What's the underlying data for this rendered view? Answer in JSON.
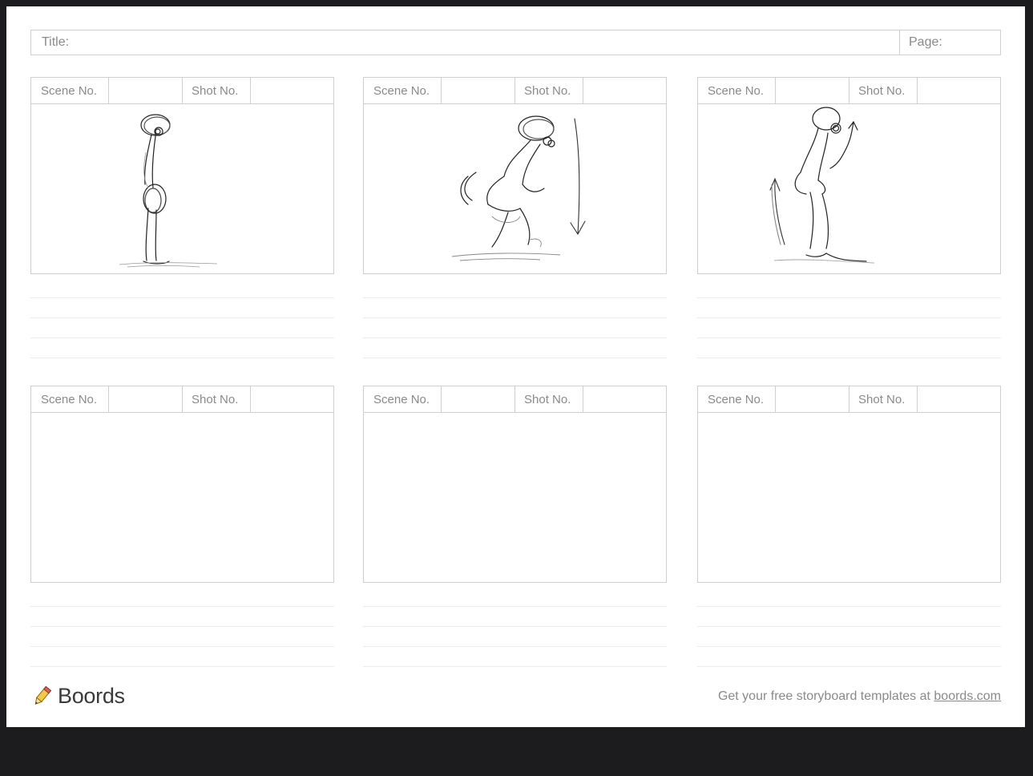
{
  "header": {
    "title_label": "Title:",
    "page_label": "Page:"
  },
  "frames": [
    {
      "scene_label": "Scene No.",
      "shot_label": "Shot No.",
      "sketch": "standing-figure"
    },
    {
      "scene_label": "Scene No.",
      "shot_label": "Shot No.",
      "sketch": "crouching-figure-down-arrow"
    },
    {
      "scene_label": "Scene No.",
      "shot_label": "Shot No.",
      "sketch": "rising-figure-up-arrows"
    },
    {
      "scene_label": "Scene No.",
      "shot_label": "Shot No.",
      "sketch": ""
    },
    {
      "scene_label": "Scene No.",
      "shot_label": "Shot No.",
      "sketch": ""
    },
    {
      "scene_label": "Scene No.",
      "shot_label": "Shot No.",
      "sketch": ""
    }
  ],
  "footer": {
    "brand": "Boords",
    "logo_icon": "pencil-logo-icon",
    "promo_text": "Get your free storyboard templates at ",
    "promo_link": "boords.com"
  },
  "colors": {
    "page_bg": "#1c1c1f",
    "sheet_bg": "#ffffff",
    "border": "#cfcfcf",
    "label_text": "#8a8a8a"
  }
}
